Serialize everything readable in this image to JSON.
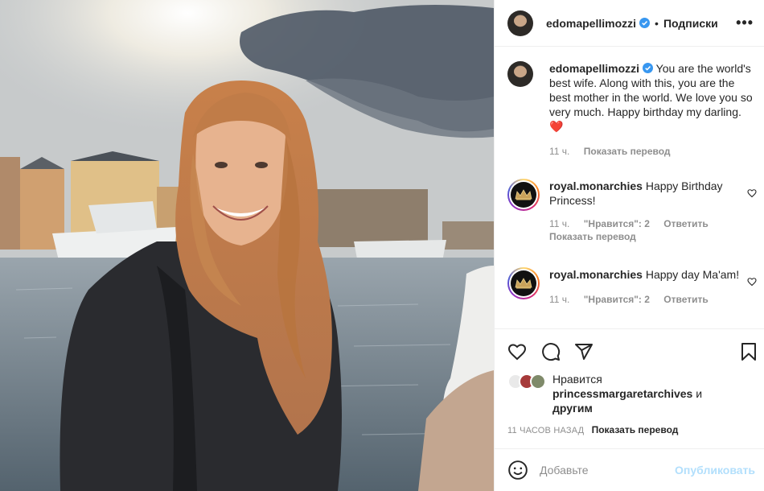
{
  "post": {
    "username": "edomapellimozzi",
    "separator": "•",
    "follow_label": "Подписки",
    "more_label": "•••"
  },
  "caption": {
    "username": "edomapellimozzi",
    "text": "You are the world's best wife. Along with this, you are the best mother in the world. We love you so very much. Happy birthday my darling. ❤️",
    "time": "11 ч.",
    "translate": "Показать перевод"
  },
  "comments": [
    {
      "username": "royal.monarchies",
      "text": "Happy Birthday Princess!",
      "time": "11 ч.",
      "likes": "\"Нравится\": 2",
      "reply": "Ответить",
      "translate": "Показать перевод"
    },
    {
      "username": "royal.monarchies",
      "text": "Happy day Ma'am!",
      "time": "11 ч.",
      "likes": "\"Нравится\": 2",
      "reply": "Ответить"
    }
  ],
  "likes": {
    "prefix": "Нравится",
    "user": "princessmargaretarchives",
    "conj": "и",
    "others": "другим"
  },
  "footer": {
    "time_ago": "11 ЧАСОВ НАЗАД",
    "translate": "Показать перевод",
    "comment_placeholder": "Добавьте",
    "post_label": "Опубликовать"
  },
  "colors": {
    "verified": "#3897f0",
    "heart": "#ed4956",
    "link_disabled": "#b2dffc",
    "muted": "#8e8e8e"
  },
  "icons": [
    "like-icon",
    "comment-icon",
    "share-icon",
    "save-icon",
    "emoji-icon",
    "verified-icon",
    "more-icon",
    "crown-icon"
  ]
}
